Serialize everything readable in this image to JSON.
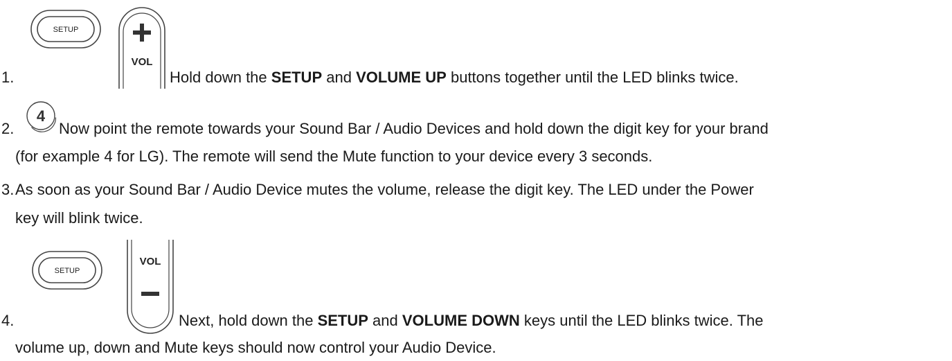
{
  "steps": [
    {
      "number": "1.",
      "pre": "Hold down the ",
      "bold1": "SETUP",
      "mid": " and ",
      "bold2": "VOLUME UP",
      "post": " buttons together until the LED blinks twice."
    },
    {
      "number": "2.",
      "line1": "Now point the remote towards your Sound Bar / Audio Devices and hold down the digit key for your brand",
      "line2": "(for example 4 for LG). The remote will send the Mute function to your device every 3 seconds."
    },
    {
      "number": "3.",
      "line1": "As soon as your Sound Bar / Audio Device mutes the volume, release the digit key. The LED under the Power",
      "line2": "key will blink twice."
    },
    {
      "number": "4.",
      "pre": "Next, hold down the ",
      "bold1": "SETUP",
      "mid": " and ",
      "bold2": "VOLUME DOWN",
      "post": " keys until the LED blinks twice. The",
      "line2": "volume up, down and Mute keys should now control your Audio Device."
    }
  ],
  "buttons": {
    "setup_label": "SETUP",
    "vol_label": "VOL",
    "plus_symbol": "+",
    "minus_symbol": "—",
    "digit_label": "4"
  }
}
